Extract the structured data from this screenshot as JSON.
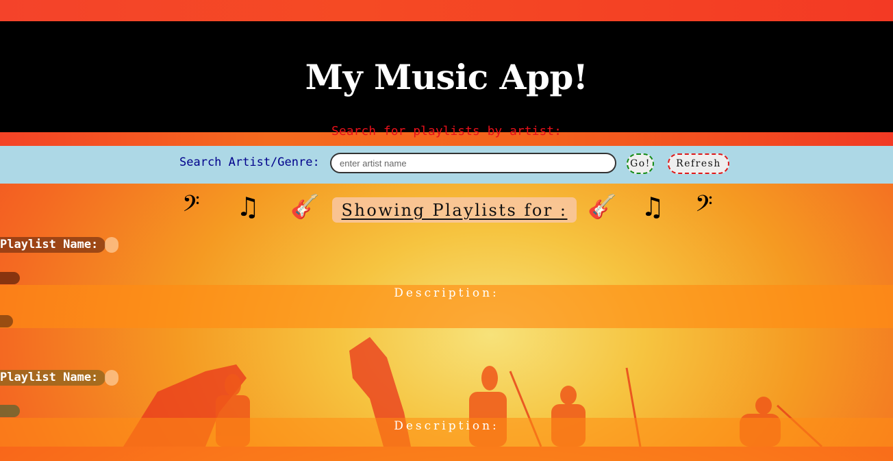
{
  "header": {
    "title": "My Music App!",
    "subtitle": "Search for playlists by artist:"
  },
  "search": {
    "label": "Search Artist/Genre:",
    "placeholder": "enter artist name",
    "value": "",
    "go_label": "Go!",
    "refresh_label": "Refresh"
  },
  "banner": {
    "left_icons": [
      "bass-clef-icon",
      "music-notes-icon",
      "guitar-icon"
    ],
    "right_icons": [
      "guitar-icon",
      "music-notes-icon",
      "bass-clef-icon"
    ],
    "glyphs": {
      "bass_clef": "𝄢",
      "notes": "♫",
      "guitar": "🎸"
    },
    "heading": "Showing Playlists for :"
  },
  "playlists": [
    {
      "name_label": "Playlist Name:",
      "name": "",
      "description_label": "Description:",
      "description": ""
    },
    {
      "name_label": "Playlist Name:",
      "name": "",
      "description_label": "Description:",
      "description": ""
    }
  ],
  "colors": {
    "header_bg": "#000000",
    "title": "#ffffff",
    "subtitle": "#e8101a",
    "search_bar_bg": "#add8e6",
    "search_label": "#00008b",
    "go_border": "#138a13",
    "refresh_border": "#e01818"
  }
}
